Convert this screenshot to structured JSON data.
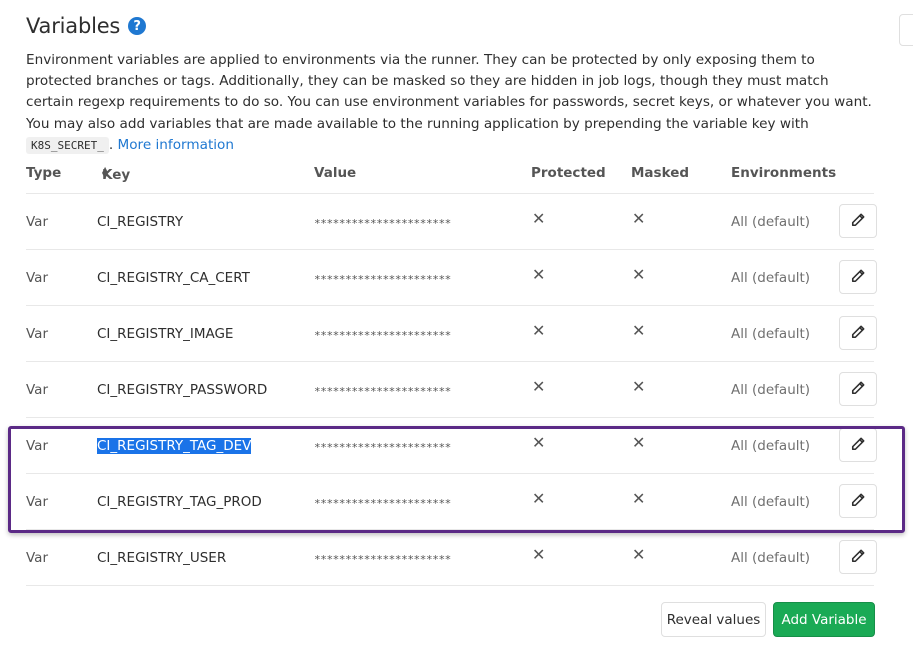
{
  "section": {
    "title": "Variables",
    "help_glyph": "?"
  },
  "description": {
    "text_before_code": "Environment variables are applied to environments via the runner. They can be protected by only exposing them to protected branches or tags. Additionally, they can be masked so they are hidden in job logs, though they must match certain regexp requirements to do so. You can use environment variables for passwords, secret keys, or whatever you want. You may also add variables that are made available to the running application by prepending the variable key with ",
    "code": "K8S_SECRET_",
    "text_after_code": ". ",
    "link": "More information"
  },
  "table": {
    "headers": {
      "type": "Type",
      "key": "Key",
      "value": "Value",
      "protected": "Protected",
      "masked": "Masked",
      "environments": "Environments"
    },
    "rows": [
      {
        "type": "Var",
        "key": "CI_REGISTRY",
        "value": "**********************",
        "protected": "✕",
        "masked": "✕",
        "env": "All (default)"
      },
      {
        "type": "Var",
        "key": "CI_REGISTRY_CA_CERT",
        "value": "**********************",
        "protected": "✕",
        "masked": "✕",
        "env": "All (default)"
      },
      {
        "type": "Var",
        "key": "CI_REGISTRY_IMAGE",
        "value": "**********************",
        "protected": "✕",
        "masked": "✕",
        "env": "All (default)"
      },
      {
        "type": "Var",
        "key": "CI_REGISTRY_PASSWORD",
        "value": "**********************",
        "protected": "✕",
        "masked": "✕",
        "env": "All (default)"
      },
      {
        "type": "Var",
        "key": "CI_REGISTRY_TAG_DEV",
        "value": "**********************",
        "protected": "✕",
        "masked": "✕",
        "env": "All (default)",
        "selected": true
      },
      {
        "type": "Var",
        "key": "CI_REGISTRY_TAG_PROD",
        "value": "**********************",
        "protected": "✕",
        "masked": "✕",
        "env": "All (default)"
      },
      {
        "type": "Var",
        "key": "CI_REGISTRY_USER",
        "value": "**********************",
        "protected": "✕",
        "masked": "✕",
        "env": "All (default)"
      }
    ]
  },
  "buttons": {
    "reveal": "Reveal values",
    "add": "Add Variable"
  },
  "colors": {
    "accent": "#1f78d1",
    "add_button": "#1aaa55",
    "highlight_border": "#5b2a86",
    "selection": "#1a73e8"
  },
  "icons": {
    "help": "question-circle-icon",
    "sort": "sort-icon",
    "edit": "pencil-icon",
    "not_set": "x-icon"
  }
}
